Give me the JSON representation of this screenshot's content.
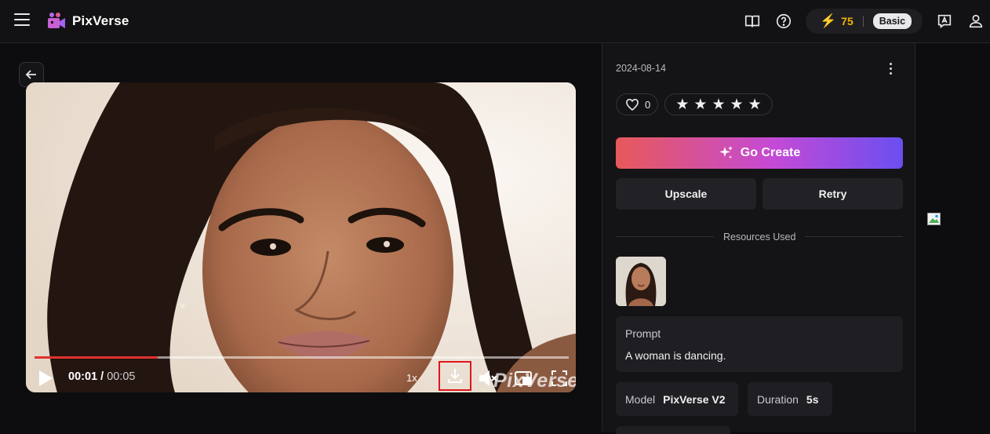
{
  "app": {
    "name": "PixVerse"
  },
  "header": {
    "credits": "75",
    "plan": "Basic",
    "icons": [
      "menu-icon",
      "book-icon",
      "help-icon",
      "bolt-icon",
      "feedback-icon",
      "user-icon"
    ]
  },
  "player": {
    "current_time": "00:01",
    "separator": "/",
    "total_time": "00:05",
    "speed": "1x",
    "progress_fraction": 0.23,
    "watermark": "PixVerse"
  },
  "details": {
    "date": "2024-08-14",
    "likes": "0",
    "rating_stars": 5,
    "go_create_label": "Go Create",
    "upscale_label": "Upscale",
    "retry_label": "Retry",
    "resources_label": "Resources Used",
    "prompt_title": "Prompt",
    "prompt_text": "A woman is dancing.",
    "model_key": "Model",
    "model_value": "PixVerse V2",
    "duration_key": "Duration",
    "duration_value": "5s"
  },
  "colors": {
    "accent_red": "#e0322f",
    "credit_gold": "#f4b400",
    "highlight_box": "#e0151c"
  }
}
